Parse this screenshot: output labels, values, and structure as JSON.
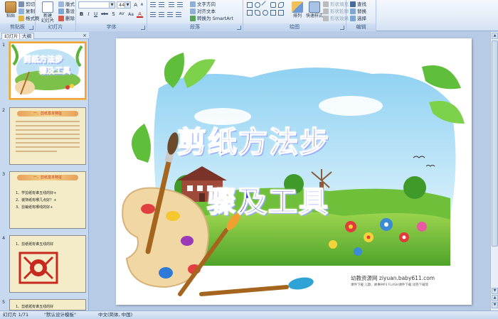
{
  "ribbon": {
    "clipboard": {
      "label": "剪贴板",
      "paste": "粘贴",
      "cut": "剪切",
      "copy": "复制",
      "format_painter": "格式刷"
    },
    "slides": {
      "label": "幻灯片",
      "new_slide": "新建\n幻灯片",
      "layout": "版式",
      "reset": "重设",
      "delete": "删除"
    },
    "font": {
      "label": "字体",
      "font_name": "",
      "font_size": "44",
      "bold": "B",
      "italic": "I",
      "underline": "U",
      "strike": "abc",
      "shadow": "S",
      "spacing": "AV",
      "case": "Aa",
      "color": "A"
    },
    "paragraph": {
      "label": "段落",
      "text_direction": "文字方向",
      "align_text": "对齐文本",
      "smartart": "转换为 SmartArt"
    },
    "drawing": {
      "label": "绘图",
      "arrange": "排列",
      "quick_styles": "快速样式",
      "shape_fill": "形状填充",
      "shape_outline": "形状轮廓",
      "shape_effects": "形状效果"
    },
    "editing": {
      "label": "编辑",
      "find": "查找",
      "replace": "替换",
      "select": "选择"
    }
  },
  "left_panel": {
    "tabs": [
      {
        "label": "幻灯片"
      },
      {
        "label": "大纲"
      }
    ],
    "close": "×",
    "thumbs": [
      {
        "num": "1",
        "title_line1": "剪纸方法步",
        "title_line2": "骤及工具"
      },
      {
        "num": "2",
        "heading": "一、剪纸基本特征"
      },
      {
        "num": "3",
        "heading": "一、剪纸基本特征",
        "items": [
          "1、学剪纸有谁五线的好+",
          "2、装饰纸有哪几点好？+",
          "3、剪裁纸有哪线的好+"
        ]
      },
      {
        "num": "4",
        "items": [
          "1、剪纸纸有谁五线的好"
        ]
      },
      {
        "num": "5",
        "items": [
          "1、剪纸纸有谁五线的好"
        ]
      }
    ]
  },
  "slide": {
    "title_line1": "剪纸方法步",
    "title_line2": "骤及工具",
    "watermark": "幼教资源网  ziyuan.baby611.com",
    "watermark_sub": "课件下载  儿歌、故事MP3  FLASH课件下载  试卷下载等"
  },
  "status": {
    "slide_info": "幻灯片 1/71",
    "theme": "\"默认设计模板\"",
    "language": "中文(简体, 中国)"
  },
  "colors": {
    "title_blue": "#1e2fd8",
    "selection_orange": "#f3a23a",
    "ribbon_bg": "#e4edf8"
  }
}
